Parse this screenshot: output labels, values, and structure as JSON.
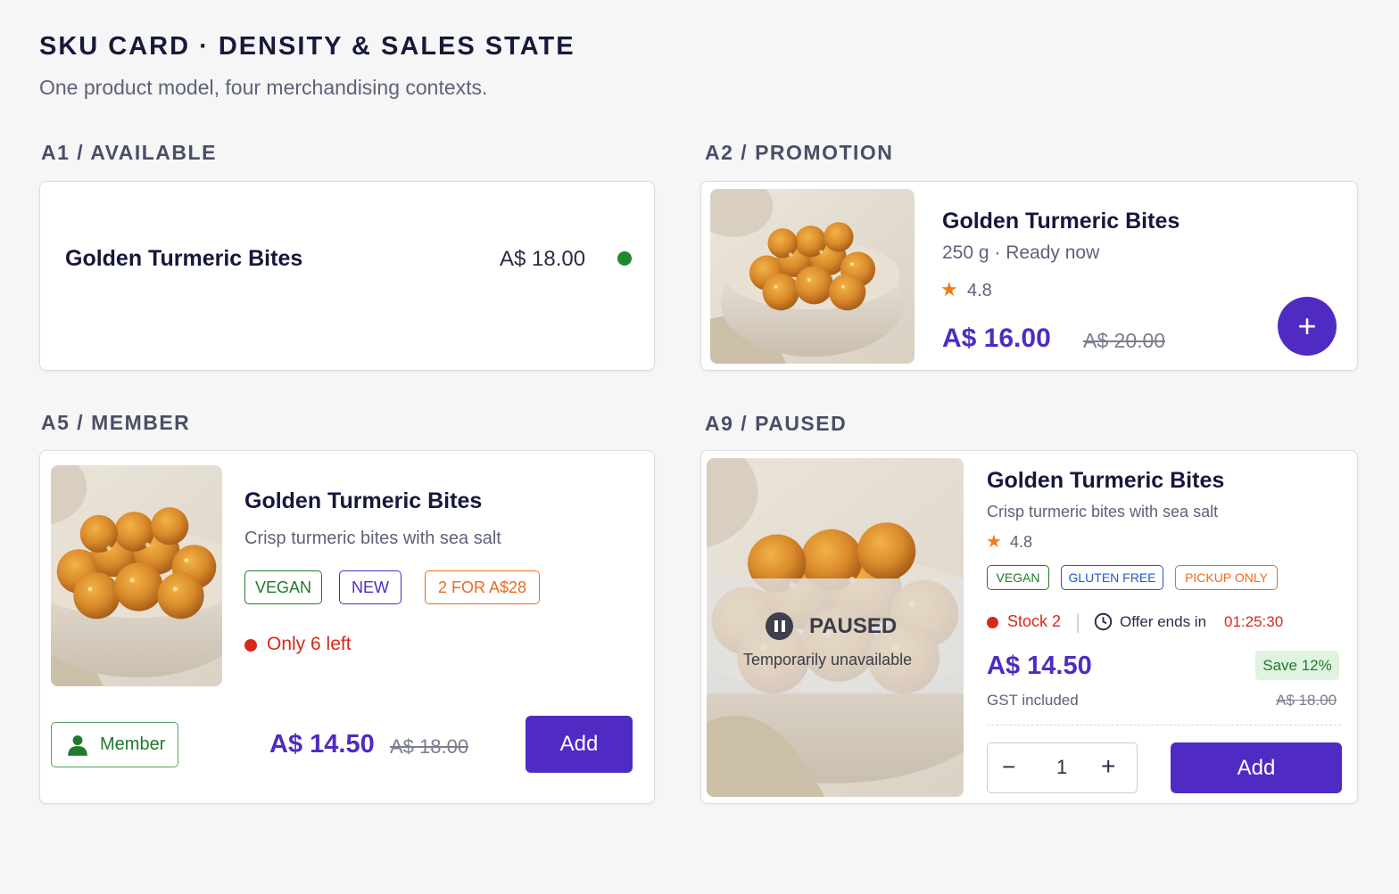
{
  "header": {
    "title": "SKU CARD · DENSITY & SALES STATE",
    "subtitle": "One product model, four merchandising contexts."
  },
  "product": {
    "name": "Golden Turmeric Bites"
  },
  "colors": {
    "accent": "#4f2bc4",
    "available_dot": "#1f8a2c",
    "stock_red": "#d8281c",
    "vegan": "#1f7a2c",
    "new": "#4f2bc4",
    "promo": "#ee6a1f",
    "gluten_free": "#1f59c9",
    "save_bg": "#dff3df"
  },
  "a1": {
    "label": "A1 / AVAILABLE",
    "name": "Golden Turmeric Bites",
    "price": "A$ 18.00",
    "status_icon": "available-dot"
  },
  "a2": {
    "label": "A2 / PROMOTION",
    "name": "Golden Turmeric Bites",
    "meta": "250 g · Ready now",
    "star_icon": "★",
    "rating": "4.8",
    "price": "A$ 16.00",
    "was_price": "A$ 20.00",
    "add_icon": "+"
  },
  "a5": {
    "label": "A5 / MEMBER",
    "name": "Golden Turmeric Bites",
    "description": "Crisp turmeric bites with sea salt",
    "badges": [
      "VEGAN",
      "NEW",
      "2 FOR A$28"
    ],
    "stock_text": "Only 6 left",
    "member_label": "Member",
    "price": "A$ 14.50",
    "was_price": "A$ 18.00",
    "add_label": "Add"
  },
  "a9": {
    "label": "A9 / PAUSED",
    "name": "Golden Turmeric Bites",
    "description": "Crisp turmeric bites with sea salt",
    "star_icon": "★",
    "rating": "4.8",
    "badges": [
      "VEGAN",
      "GLUTEN FREE",
      "PICKUP ONLY"
    ],
    "paused_title": "PAUSED",
    "paused_subtitle": "Temporarily unavailable",
    "stock_text": "Stock 2",
    "offer_text": "Offer ends in",
    "offer_time": "01:25:30",
    "price": "A$ 14.50",
    "save_text": "Save 12%",
    "tax_text": "GST included",
    "was_price": "A$ 18.00",
    "minus_icon": "−",
    "quantity": "1",
    "plus_icon": "+",
    "add_label": "Add"
  }
}
